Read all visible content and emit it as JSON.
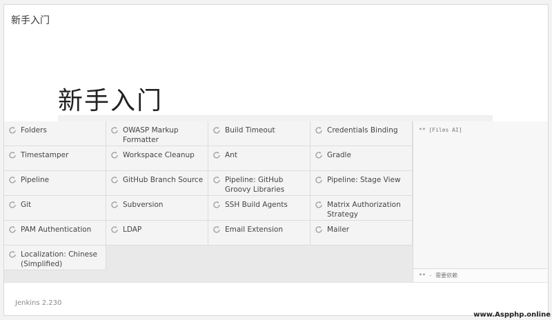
{
  "header": {
    "title": "新手入门"
  },
  "hero": {
    "title": "新手入门"
  },
  "plugins": [
    [
      "Folders",
      "OWASP Markup Formatter",
      "Build Timeout",
      "Credentials Binding"
    ],
    [
      "Timestamper",
      "Workspace Cleanup",
      "Ant",
      "Gradle"
    ],
    [
      "Pipeline",
      "GitHub Branch Source",
      "Pipeline: GitHub Groovy Libraries",
      "Pipeline: Stage View"
    ],
    [
      "Git",
      "Subversion",
      "SSH Build Agents",
      "Matrix Authorization Strategy"
    ],
    [
      "PAM Authentication",
      "LDAP",
      "Email Extension",
      "Mailer"
    ],
    [
      "Localization: Chinese (Simplified)"
    ]
  ],
  "log": {
    "top": "** [Files AI]",
    "bottom": "** - 需要依赖"
  },
  "footer": {
    "version": "Jenkins 2.230"
  },
  "watermark": "www.Aspphp.online",
  "colors": {
    "accent": "#9aa7a0",
    "cell_bg": "#f4f4f4",
    "area_bg": "#e9e9e9"
  }
}
